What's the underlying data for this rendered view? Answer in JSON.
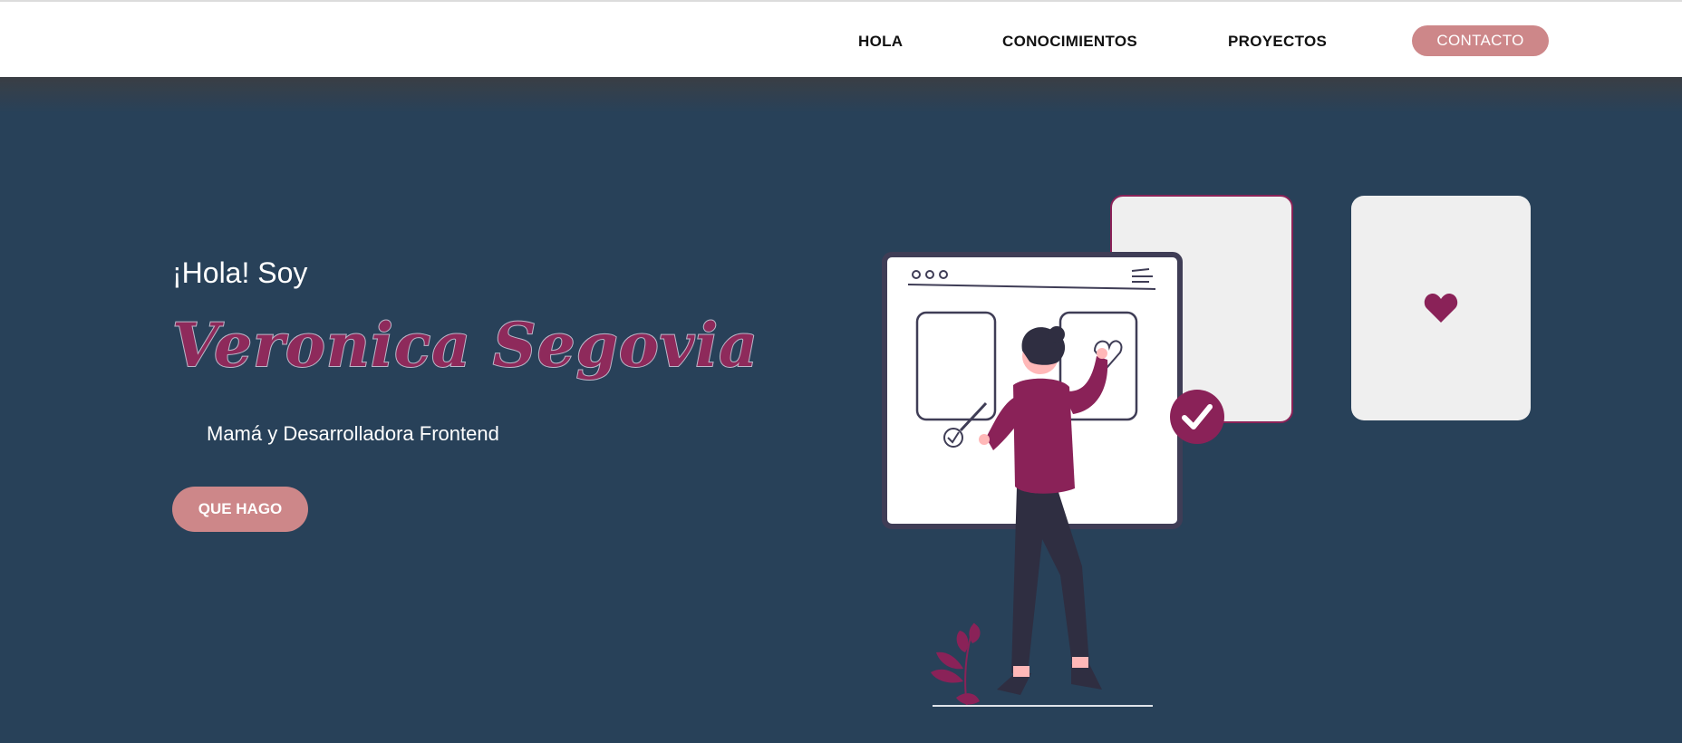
{
  "nav": {
    "links": [
      "HOLA",
      "CONOCIMIENTOS",
      "PROYECTOS"
    ],
    "contact_label": "CONTACTO"
  },
  "hero": {
    "greeting": "¡Hola! Soy",
    "name": "Veronica Segovia",
    "subtitle": "Mamá y Desarrolladora Frontend",
    "cta_label": "QUE HAGO"
  },
  "illustration": {
    "icons": [
      "heart-icon",
      "check-icon",
      "browser-window-icon",
      "plant-icon"
    ]
  },
  "colors": {
    "background": "#284159",
    "accent": "#cd8789",
    "brand": "#8a2258",
    "card": "#efefef"
  }
}
